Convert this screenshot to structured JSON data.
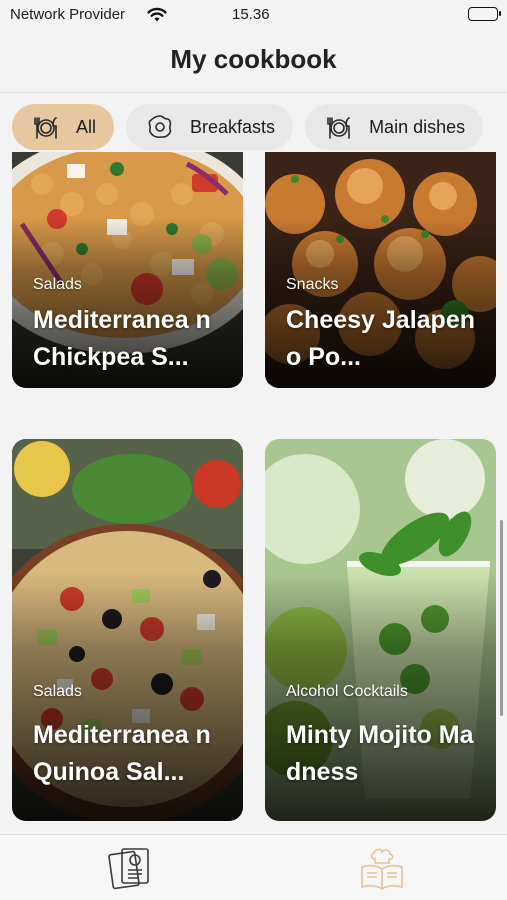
{
  "status_bar": {
    "carrier": "Network Provider",
    "time": "15.36"
  },
  "header": {
    "title": "My cookbook"
  },
  "filters": [
    {
      "label": "All",
      "icon": "plate-cutlery-icon",
      "active": true
    },
    {
      "label": "Breakfasts",
      "icon": "fried-egg-icon",
      "active": false
    },
    {
      "label": "Main dishes",
      "icon": "plate-cutlery-icon",
      "active": false
    }
  ],
  "recipes": [
    {
      "category": "Salads",
      "name": "Mediterranea n Chickpea S..."
    },
    {
      "category": "Snacks",
      "name": "Cheesy Jalapeno Po..."
    },
    {
      "category": "Salads",
      "name": "Mediterranea n Quinoa Sal..."
    },
    {
      "category": "Alcohol Cocktails",
      "name": "Minty Mojito Madness"
    }
  ],
  "tabbar": [
    {
      "icon": "recipe-cards-icon",
      "active": false
    },
    {
      "icon": "chef-book-icon",
      "active": true
    }
  ],
  "colors": {
    "accent": "#e6c7a0",
    "chip": "#e9e8e8",
    "background": "#f4f3f3",
    "active_tab": "#e3c39a"
  }
}
